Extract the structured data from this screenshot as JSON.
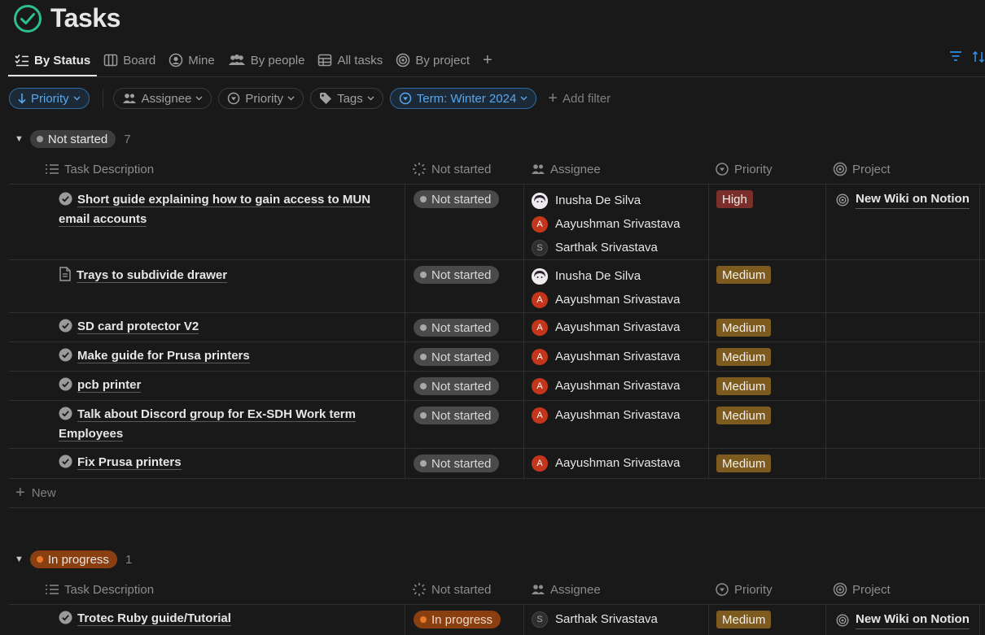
{
  "page": {
    "title": "Tasks"
  },
  "tabs": [
    {
      "label": "By Status",
      "icon": "checklist-icon",
      "active": true
    },
    {
      "label": "Board",
      "icon": "board-icon"
    },
    {
      "label": "Mine",
      "icon": "user-circle-icon"
    },
    {
      "label": "By people",
      "icon": "people-icon"
    },
    {
      "label": "All tasks",
      "icon": "table-icon"
    },
    {
      "label": "By project",
      "icon": "target-icon"
    }
  ],
  "filters": {
    "sort_chip": "Priority",
    "assignee": "Assignee",
    "priority": "Priority",
    "tags": "Tags",
    "term": "Term: Winter 2024",
    "add_filter": "Add filter"
  },
  "columns": {
    "task": "Task Description",
    "status": "Not started",
    "assignee": "Assignee",
    "priority": "Priority",
    "project": "Project"
  },
  "groups": {
    "not_started": {
      "label": "Not started",
      "count": "7",
      "new_label": "New",
      "rows": [
        {
          "task": "Short guide explaining how to gain access to MUN email accounts",
          "status": "Not started",
          "assignees": [
            "Inusha De Silva",
            "Aayushman Srivastava",
            "Sarthak Srivastava"
          ],
          "priority": "High",
          "project": "New Wiki on Notion"
        },
        {
          "task": "Trays to subdivide drawer",
          "status": "Not started",
          "assignees": [
            "Inusha De Silva",
            "Aayushman Srivastava"
          ],
          "priority": "Medium",
          "project": ""
        },
        {
          "task": "SD card protector V2",
          "status": "Not started",
          "assignees": [
            "Aayushman Srivastava"
          ],
          "priority": "Medium",
          "project": ""
        },
        {
          "task": "Make guide for Prusa printers",
          "status": "Not started",
          "assignees": [
            "Aayushman Srivastava"
          ],
          "priority": "Medium",
          "project": ""
        },
        {
          "task": "pcb printer",
          "status": "Not started",
          "assignees": [
            "Aayushman Srivastava"
          ],
          "priority": "Medium",
          "project": ""
        },
        {
          "task": "Talk about Discord group for Ex-SDH Work term Employees",
          "status": "Not started",
          "assignees": [
            "Aayushman Srivastava"
          ],
          "priority": "Medium",
          "project": ""
        },
        {
          "task": "Fix Prusa printers",
          "status": "Not started",
          "assignees": [
            "Aayushman Srivastava"
          ],
          "priority": "Medium",
          "project": ""
        }
      ]
    },
    "in_progress": {
      "label": "In progress",
      "count": "1",
      "rows": [
        {
          "task": "Trotec Ruby guide/Tutorial",
          "status": "In progress",
          "assignees": [
            "Sarthak Srivastava"
          ],
          "priority": "Medium",
          "project": "New Wiki on Notion"
        }
      ]
    }
  },
  "avatar_initials": {
    "aayushman": "A",
    "sarthak": "S"
  },
  "colors": {
    "accent": "#2e8ae6",
    "title_check": "#2dbf8a",
    "high": "#7a2f2a",
    "medium": "#7d5a1e",
    "in_progress": "#8a3f10"
  }
}
